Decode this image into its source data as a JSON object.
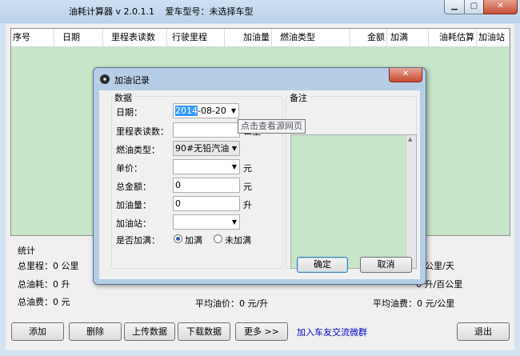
{
  "window": {
    "app_title": "油耗计算器 v 2.0.1.1",
    "car_model": "爱车型号：未选择车型",
    "minimize": "▁",
    "maximize": "▢",
    "close": "✕"
  },
  "grid": {
    "columns": [
      "序号",
      "日期",
      "里程表读数",
      "行驶里程",
      "加油量",
      "燃油类型",
      "金额",
      "加满",
      "油耗估算",
      "加油站"
    ]
  },
  "stats": {
    "title": "统计",
    "total_mileage": "总里程：0 公里",
    "total_fuel": "总油耗：0 升",
    "total_cost": "总油费：0 元",
    "per_day": "公里/天",
    "per_100km": "0 升/百公里",
    "avg_price": "平均油价：0 元/升",
    "avg_cost": "平均油费：0 元/公里"
  },
  "toolbar": {
    "add": "添加",
    "delete": "删除",
    "upload": "上传数据",
    "download": "下载数据",
    "more": "更多 >>",
    "join_link": "加入车友交流微群",
    "exit": "退出"
  },
  "dialog": {
    "title": "加油记录",
    "close": "✕",
    "data_group": "数据",
    "notes_group": "备注",
    "date_label": "日期：",
    "date_year": "2014",
    "date_rest": "-08-20",
    "odometer_label": "里程表读数：",
    "odometer_unit": "公里",
    "fuel_type_label": "燃油类型：",
    "fuel_type_value": "90#无铅汽油",
    "unit_price_label": "单价：",
    "unit_price_unit": "元",
    "total_label": "总金额：",
    "total_value": "0",
    "total_unit": "元",
    "volume_label": "加油量：",
    "volume_value": "0",
    "volume_unit": "升",
    "station_label": "加油站：",
    "full_label": "是否加满：",
    "full_yes": "加满",
    "full_no": "未加满",
    "ok": "确定",
    "cancel": "取消",
    "tooltip": "点击查看源网页"
  }
}
